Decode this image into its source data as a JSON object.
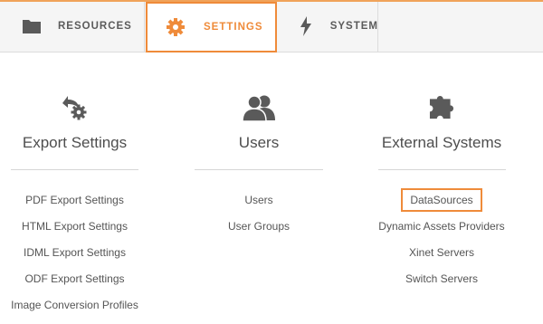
{
  "tabs": {
    "resources": {
      "label": "RESOURCES",
      "icon": "folder-icon"
    },
    "settings": {
      "label": "SETTINGS",
      "icon": "gear-icon",
      "active": true
    },
    "system": {
      "label": "SYSTEM",
      "icon": "lightning-bolt-icon"
    }
  },
  "colors": {
    "accent": "#ef8b3a",
    "text": "#555555",
    "icon": "#5a5a5a",
    "tabbar_bg": "#f5f5f5"
  },
  "sections": {
    "export": {
      "icon": "export-settings-icon",
      "title": "Export Settings",
      "links": [
        "PDF Export Settings",
        "HTML Export Settings",
        "IDML Export Settings",
        "ODF Export Settings",
        "Image Conversion Profiles"
      ]
    },
    "users": {
      "icon": "users-icon",
      "title": "Users",
      "links": [
        "Users",
        "User Groups"
      ]
    },
    "external": {
      "icon": "puzzle-piece-icon",
      "title": "External Systems",
      "links": [
        "DataSources",
        "Dynamic Assets Providers",
        "Xinet Servers",
        "Switch Servers"
      ],
      "highlighted_link": "DataSources"
    }
  }
}
